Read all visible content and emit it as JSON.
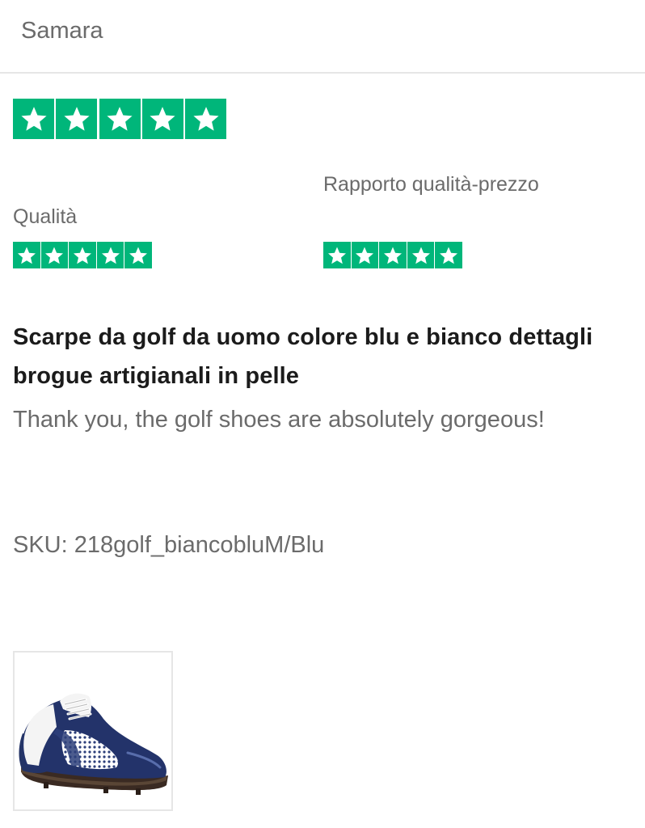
{
  "review": {
    "reviewer_name": "Samara",
    "overall_rating": 5,
    "sub_ratings": [
      {
        "label": "Qualità",
        "rating": 5
      },
      {
        "label": "Rapporto qualità-prezzo",
        "rating": 5
      }
    ],
    "title": "Scarpe da golf da uomo colore blu e bianco dettagli brogue artigianali in pelle",
    "body": "Thank you, the golf shoes are absolutely gorgeous!",
    "sku": "SKU: 218golf_biancobluM/Blu"
  },
  "colors": {
    "star_green": "#00b67a",
    "star_white": "#ffffff",
    "secondary_text": "#6b6b6b",
    "primary_text": "#1b1b1b",
    "divider": "#e6e6e6"
  },
  "icons": {
    "star": "star-icon",
    "thumbnail": "golf-shoe-image"
  }
}
